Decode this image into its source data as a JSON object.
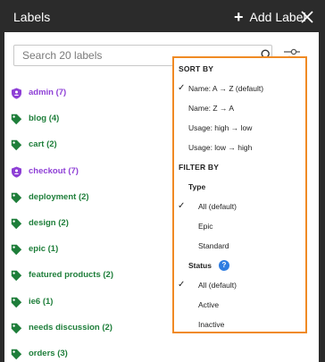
{
  "header": {
    "title": "Labels",
    "add_label": "Add Label"
  },
  "search": {
    "placeholder": "Search 20 labels"
  },
  "labels": [
    {
      "text": "admin (7)",
      "icon": "shield-icon",
      "color": "#8e3fd6"
    },
    {
      "text": "blog (4)",
      "icon": "tag-icon",
      "color": "#1e7e3a"
    },
    {
      "text": "cart (2)",
      "icon": "tag-icon",
      "color": "#1e7e3a"
    },
    {
      "text": "checkout (7)",
      "icon": "shield-icon",
      "color": "#8e3fd6"
    },
    {
      "text": "deployment (2)",
      "icon": "tag-icon",
      "color": "#1e7e3a"
    },
    {
      "text": "design (2)",
      "icon": "tag-icon",
      "color": "#1e7e3a"
    },
    {
      "text": "epic (1)",
      "icon": "tag-icon",
      "color": "#1e7e3a"
    },
    {
      "text": "featured products (2)",
      "icon": "tag-icon",
      "color": "#1e7e3a"
    },
    {
      "text": "ie6 (1)",
      "icon": "tag-icon",
      "color": "#1e7e3a"
    },
    {
      "text": "needs discussion (2)",
      "icon": "tag-icon",
      "color": "#1e7e3a"
    },
    {
      "text": "orders (3)",
      "icon": "tag-icon",
      "color": "#1e7e3a"
    }
  ],
  "dropdown": {
    "sort_heading": "SORT BY",
    "sort_options": [
      {
        "label": "Name: A → Z (default)",
        "checked": true
      },
      {
        "label": "Name: Z → A",
        "checked": false
      },
      {
        "label": "Usage: high → low",
        "checked": false
      },
      {
        "label": "Usage: low → high",
        "checked": false
      }
    ],
    "filter_heading": "FILTER BY",
    "type_label": "Type",
    "type_options": [
      {
        "label": "All (default)",
        "checked": true
      },
      {
        "label": "Epic",
        "checked": false
      },
      {
        "label": "Standard",
        "checked": false
      }
    ],
    "status_label": "Status",
    "status_help": "?",
    "status_options": [
      {
        "label": "All (default)",
        "checked": true
      },
      {
        "label": "Active",
        "checked": false
      },
      {
        "label": "Inactive",
        "checked": false
      }
    ],
    "check_mark": "✓"
  },
  "colors": {
    "header_bg": "#2b2b2b",
    "accent_border": "#f08a24",
    "help_blue": "#2f7de1"
  }
}
